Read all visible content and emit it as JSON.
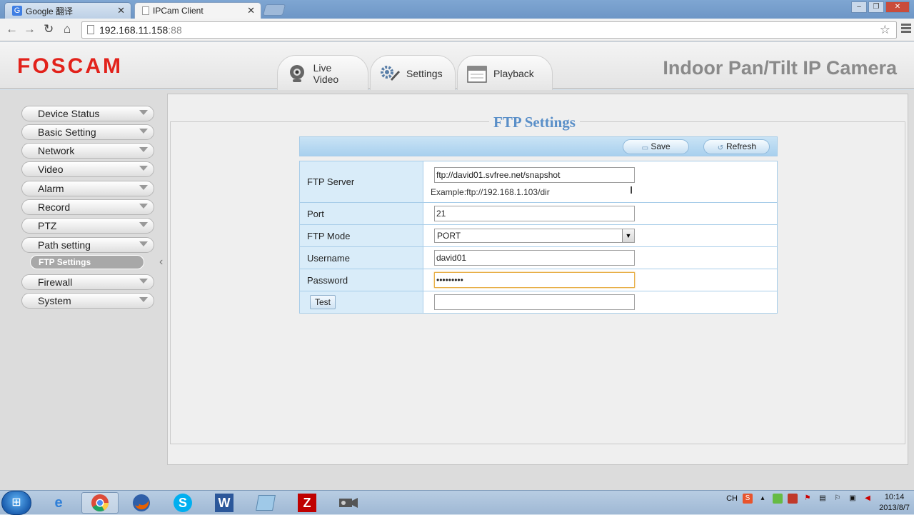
{
  "browser": {
    "tabs": [
      {
        "label": "Google 翻译"
      },
      {
        "label": "IPCam Client"
      }
    ],
    "address_host": "192.168.11.158",
    "address_port": ":88"
  },
  "header": {
    "logo": "FOSCAM",
    "title": "Indoor Pan/Tilt IP Camera",
    "nav": [
      {
        "label": "Live Video"
      },
      {
        "label": "Settings"
      },
      {
        "label": "Playback"
      }
    ]
  },
  "sidebar": {
    "items": [
      {
        "label": "Device Status"
      },
      {
        "label": "Basic Setting"
      },
      {
        "label": "Network"
      },
      {
        "label": "Video"
      },
      {
        "label": "Alarm"
      },
      {
        "label": "Record"
      },
      {
        "label": "PTZ"
      },
      {
        "label": "Path setting"
      },
      {
        "label": "FTP Settings"
      },
      {
        "label": "Firewall"
      },
      {
        "label": "System"
      }
    ]
  },
  "form": {
    "title": "FTP Settings",
    "save_label": "Save",
    "refresh_label": "Refresh",
    "ftp_server_label": "FTP Server",
    "ftp_server_value": "ftp://david01.svfree.net/snapshot",
    "ftp_server_example": "Example:ftp://192.168.1.103/dir",
    "port_label": "Port",
    "port_value": "21",
    "mode_label": "FTP Mode",
    "mode_value": "PORT",
    "username_label": "Username",
    "username_value": "david01",
    "password_label": "Password",
    "password_value": "•••••••••",
    "test_label": "Test",
    "test_value": ""
  },
  "taskbar": {
    "tray_lang": "CH",
    "clock_time": "10:14",
    "clock_date": "2013/8/7"
  }
}
